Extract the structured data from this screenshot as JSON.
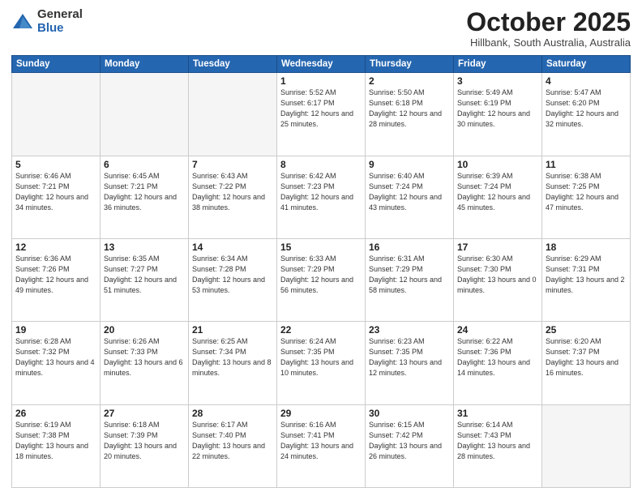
{
  "logo": {
    "general": "General",
    "blue": "Blue"
  },
  "header": {
    "month": "October 2025",
    "location": "Hillbank, South Australia, Australia"
  },
  "days_of_week": [
    "Sunday",
    "Monday",
    "Tuesday",
    "Wednesday",
    "Thursday",
    "Friday",
    "Saturday"
  ],
  "weeks": [
    [
      {
        "day": "",
        "info": ""
      },
      {
        "day": "",
        "info": ""
      },
      {
        "day": "",
        "info": ""
      },
      {
        "day": "1",
        "info": "Sunrise: 5:52 AM\nSunset: 6:17 PM\nDaylight: 12 hours\nand 25 minutes."
      },
      {
        "day": "2",
        "info": "Sunrise: 5:50 AM\nSunset: 6:18 PM\nDaylight: 12 hours\nand 28 minutes."
      },
      {
        "day": "3",
        "info": "Sunrise: 5:49 AM\nSunset: 6:19 PM\nDaylight: 12 hours\nand 30 minutes."
      },
      {
        "day": "4",
        "info": "Sunrise: 5:47 AM\nSunset: 6:20 PM\nDaylight: 12 hours\nand 32 minutes."
      }
    ],
    [
      {
        "day": "5",
        "info": "Sunrise: 6:46 AM\nSunset: 7:21 PM\nDaylight: 12 hours\nand 34 minutes."
      },
      {
        "day": "6",
        "info": "Sunrise: 6:45 AM\nSunset: 7:21 PM\nDaylight: 12 hours\nand 36 minutes."
      },
      {
        "day": "7",
        "info": "Sunrise: 6:43 AM\nSunset: 7:22 PM\nDaylight: 12 hours\nand 38 minutes."
      },
      {
        "day": "8",
        "info": "Sunrise: 6:42 AM\nSunset: 7:23 PM\nDaylight: 12 hours\nand 41 minutes."
      },
      {
        "day": "9",
        "info": "Sunrise: 6:40 AM\nSunset: 7:24 PM\nDaylight: 12 hours\nand 43 minutes."
      },
      {
        "day": "10",
        "info": "Sunrise: 6:39 AM\nSunset: 7:24 PM\nDaylight: 12 hours\nand 45 minutes."
      },
      {
        "day": "11",
        "info": "Sunrise: 6:38 AM\nSunset: 7:25 PM\nDaylight: 12 hours\nand 47 minutes."
      }
    ],
    [
      {
        "day": "12",
        "info": "Sunrise: 6:36 AM\nSunset: 7:26 PM\nDaylight: 12 hours\nand 49 minutes."
      },
      {
        "day": "13",
        "info": "Sunrise: 6:35 AM\nSunset: 7:27 PM\nDaylight: 12 hours\nand 51 minutes."
      },
      {
        "day": "14",
        "info": "Sunrise: 6:34 AM\nSunset: 7:28 PM\nDaylight: 12 hours\nand 53 minutes."
      },
      {
        "day": "15",
        "info": "Sunrise: 6:33 AM\nSunset: 7:29 PM\nDaylight: 12 hours\nand 56 minutes."
      },
      {
        "day": "16",
        "info": "Sunrise: 6:31 AM\nSunset: 7:29 PM\nDaylight: 12 hours\nand 58 minutes."
      },
      {
        "day": "17",
        "info": "Sunrise: 6:30 AM\nSunset: 7:30 PM\nDaylight: 13 hours\nand 0 minutes."
      },
      {
        "day": "18",
        "info": "Sunrise: 6:29 AM\nSunset: 7:31 PM\nDaylight: 13 hours\nand 2 minutes."
      }
    ],
    [
      {
        "day": "19",
        "info": "Sunrise: 6:28 AM\nSunset: 7:32 PM\nDaylight: 13 hours\nand 4 minutes."
      },
      {
        "day": "20",
        "info": "Sunrise: 6:26 AM\nSunset: 7:33 PM\nDaylight: 13 hours\nand 6 minutes."
      },
      {
        "day": "21",
        "info": "Sunrise: 6:25 AM\nSunset: 7:34 PM\nDaylight: 13 hours\nand 8 minutes."
      },
      {
        "day": "22",
        "info": "Sunrise: 6:24 AM\nSunset: 7:35 PM\nDaylight: 13 hours\nand 10 minutes."
      },
      {
        "day": "23",
        "info": "Sunrise: 6:23 AM\nSunset: 7:35 PM\nDaylight: 13 hours\nand 12 minutes."
      },
      {
        "day": "24",
        "info": "Sunrise: 6:22 AM\nSunset: 7:36 PM\nDaylight: 13 hours\nand 14 minutes."
      },
      {
        "day": "25",
        "info": "Sunrise: 6:20 AM\nSunset: 7:37 PM\nDaylight: 13 hours\nand 16 minutes."
      }
    ],
    [
      {
        "day": "26",
        "info": "Sunrise: 6:19 AM\nSunset: 7:38 PM\nDaylight: 13 hours\nand 18 minutes."
      },
      {
        "day": "27",
        "info": "Sunrise: 6:18 AM\nSunset: 7:39 PM\nDaylight: 13 hours\nand 20 minutes."
      },
      {
        "day": "28",
        "info": "Sunrise: 6:17 AM\nSunset: 7:40 PM\nDaylight: 13 hours\nand 22 minutes."
      },
      {
        "day": "29",
        "info": "Sunrise: 6:16 AM\nSunset: 7:41 PM\nDaylight: 13 hours\nand 24 minutes."
      },
      {
        "day": "30",
        "info": "Sunrise: 6:15 AM\nSunset: 7:42 PM\nDaylight: 13 hours\nand 26 minutes."
      },
      {
        "day": "31",
        "info": "Sunrise: 6:14 AM\nSunset: 7:43 PM\nDaylight: 13 hours\nand 28 minutes."
      },
      {
        "day": "",
        "info": ""
      }
    ]
  ]
}
